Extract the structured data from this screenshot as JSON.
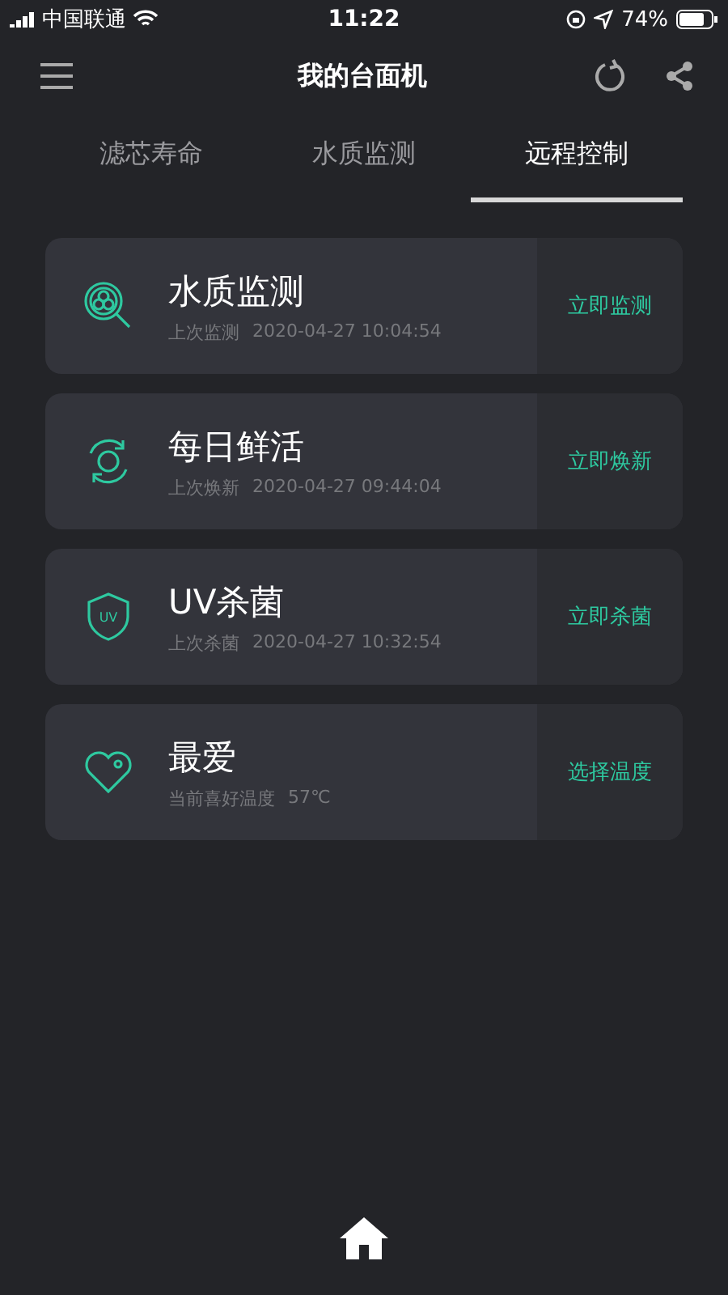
{
  "status_bar": {
    "carrier": "中国联通",
    "time": "11:22",
    "battery": "74%"
  },
  "header": {
    "title": "我的台面机"
  },
  "tabs": [
    {
      "label": "滤芯寿命",
      "selected": false
    },
    {
      "label": "水质监测",
      "selected": false
    },
    {
      "label": "远程控制",
      "selected": true
    }
  ],
  "cards": [
    {
      "kind": "water",
      "title": "水质监测",
      "caption": "上次监测",
      "value": "2020-04-27 10:04:54",
      "action": "立即监测"
    },
    {
      "kind": "refresh",
      "title": "每日鲜活",
      "caption": "上次焕新",
      "value": "2020-04-27 09:44:04",
      "action": "立即焕新"
    },
    {
      "kind": "uv",
      "icon_text": "UV",
      "title": "UV杀菌",
      "caption": "上次杀菌",
      "value": "2020-04-27 10:32:54",
      "action": "立即杀菌"
    },
    {
      "kind": "favorite",
      "title": "最爱",
      "caption": "当前喜好温度",
      "value": "57℃",
      "action": "选择温度"
    }
  ]
}
